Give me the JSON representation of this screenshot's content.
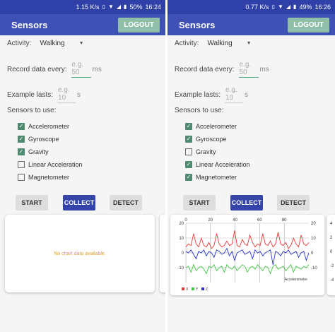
{
  "left": {
    "status": {
      "speed": "1.15 K/s",
      "battery": "50%",
      "time": "16:24"
    },
    "app_bar": {
      "title": "Sensors",
      "logout": "LOGOUT"
    },
    "activity": {
      "label": "Activity:",
      "value": "Walking"
    },
    "record": {
      "label": "Record data every:",
      "placeholder": "e.g. 50",
      "unit": "ms"
    },
    "lasts": {
      "label": "Example lasts:",
      "placeholder": "e.g. 10",
      "unit": "s"
    },
    "sensors_title": "Sensors to use:",
    "sensors": [
      {
        "label": "Accelerometer",
        "checked": true
      },
      {
        "label": "Gyroscope",
        "checked": true
      },
      {
        "label": "Gravity",
        "checked": true
      },
      {
        "label": "Linear Acceleration",
        "checked": false
      },
      {
        "label": "Magnetometer",
        "checked": false
      }
    ],
    "buttons": {
      "start": "START",
      "collect": "COLLECT",
      "detect": "DETECT"
    },
    "no_data": "No chart data available."
  },
  "right": {
    "status": {
      "speed": "0.77 K/s",
      "battery": "49%",
      "time": "16:26"
    },
    "app_bar": {
      "title": "Sensors",
      "logout": "LOGOUT"
    },
    "activity": {
      "label": "Activity:",
      "value": "Walking"
    },
    "record": {
      "label": "Record data every:",
      "placeholder": "e.g. 50",
      "unit": "ms"
    },
    "lasts": {
      "label": "Example lasts:",
      "placeholder": "e.g. 10",
      "unit": "s"
    },
    "sensors_title": "Sensors to use:",
    "sensors": [
      {
        "label": "Accelerometer",
        "checked": true
      },
      {
        "label": "Gyroscope",
        "checked": true
      },
      {
        "label": "Gravity",
        "checked": false
      },
      {
        "label": "Linear Acceleration",
        "checked": true
      },
      {
        "label": "Magnetometer",
        "checked": true
      }
    ],
    "buttons": {
      "start": "START",
      "collect": "COLLECT",
      "detect": "DETECT"
    },
    "peek_ticks": [
      "4",
      "2",
      "0",
      "-2",
      "-4"
    ]
  },
  "colors": {
    "primary": "#3f51b5",
    "status": "#2f41a8",
    "logout": "#8fbfa9",
    "checkbox": "#4e8a70",
    "x": "#e53935",
    "y": "#43c843",
    "z": "#2a34c8"
  },
  "chart_data": {
    "type": "line",
    "title": "",
    "description": "Accelerometer",
    "xlim": [
      0,
      100
    ],
    "ylim": [
      -20,
      20
    ],
    "x_ticks": [
      "0",
      "20",
      "40",
      "60",
      "80"
    ],
    "y_ticks": [
      "20",
      "10",
      "0",
      "-10"
    ],
    "series": [
      {
        "name": "X",
        "color": "#e53935",
        "values": [
          4,
          6,
          5,
          13,
          6,
          4,
          10,
          5,
          4,
          7,
          3,
          5,
          13,
          6,
          4,
          5,
          8,
          5,
          6,
          15,
          5,
          4,
          9,
          6,
          5,
          12,
          7,
          4,
          6,
          5,
          13,
          6,
          5,
          8,
          4,
          6,
          14,
          6,
          5,
          7,
          3,
          5,
          10,
          6,
          4,
          12,
          6,
          5,
          7
        ]
      },
      {
        "name": "Y",
        "color": "#43c843",
        "values": [
          -10,
          -9,
          -13,
          -8,
          -12,
          -10,
          -9,
          -11,
          -14,
          -9,
          -10,
          -8,
          -12,
          -10,
          -9,
          -13,
          -8,
          -10,
          -11,
          -9,
          -12,
          -10,
          -8,
          -9,
          -13,
          -10,
          -9,
          -11,
          -8,
          -10,
          -12,
          -9,
          -10,
          -14,
          -9,
          -8,
          -11,
          -10,
          -9,
          -12,
          -10,
          -8,
          -13,
          -9,
          -10,
          -11,
          -9,
          -10,
          -8
        ]
      },
      {
        "name": "Z",
        "color": "#2a34c8",
        "values": [
          1,
          0,
          2,
          -1,
          -4,
          1,
          0,
          2,
          -2,
          1,
          0,
          -3,
          2,
          1,
          -1,
          0,
          3,
          -2,
          1,
          -5,
          0,
          1,
          2,
          -1,
          0,
          1,
          -4,
          2,
          0,
          1,
          -2,
          0,
          1,
          2,
          -8,
          1,
          0,
          -2,
          1,
          0,
          2,
          -1,
          0,
          1,
          -3,
          0,
          1,
          -5,
          0
        ]
      }
    ],
    "legend": "bottom-left"
  }
}
